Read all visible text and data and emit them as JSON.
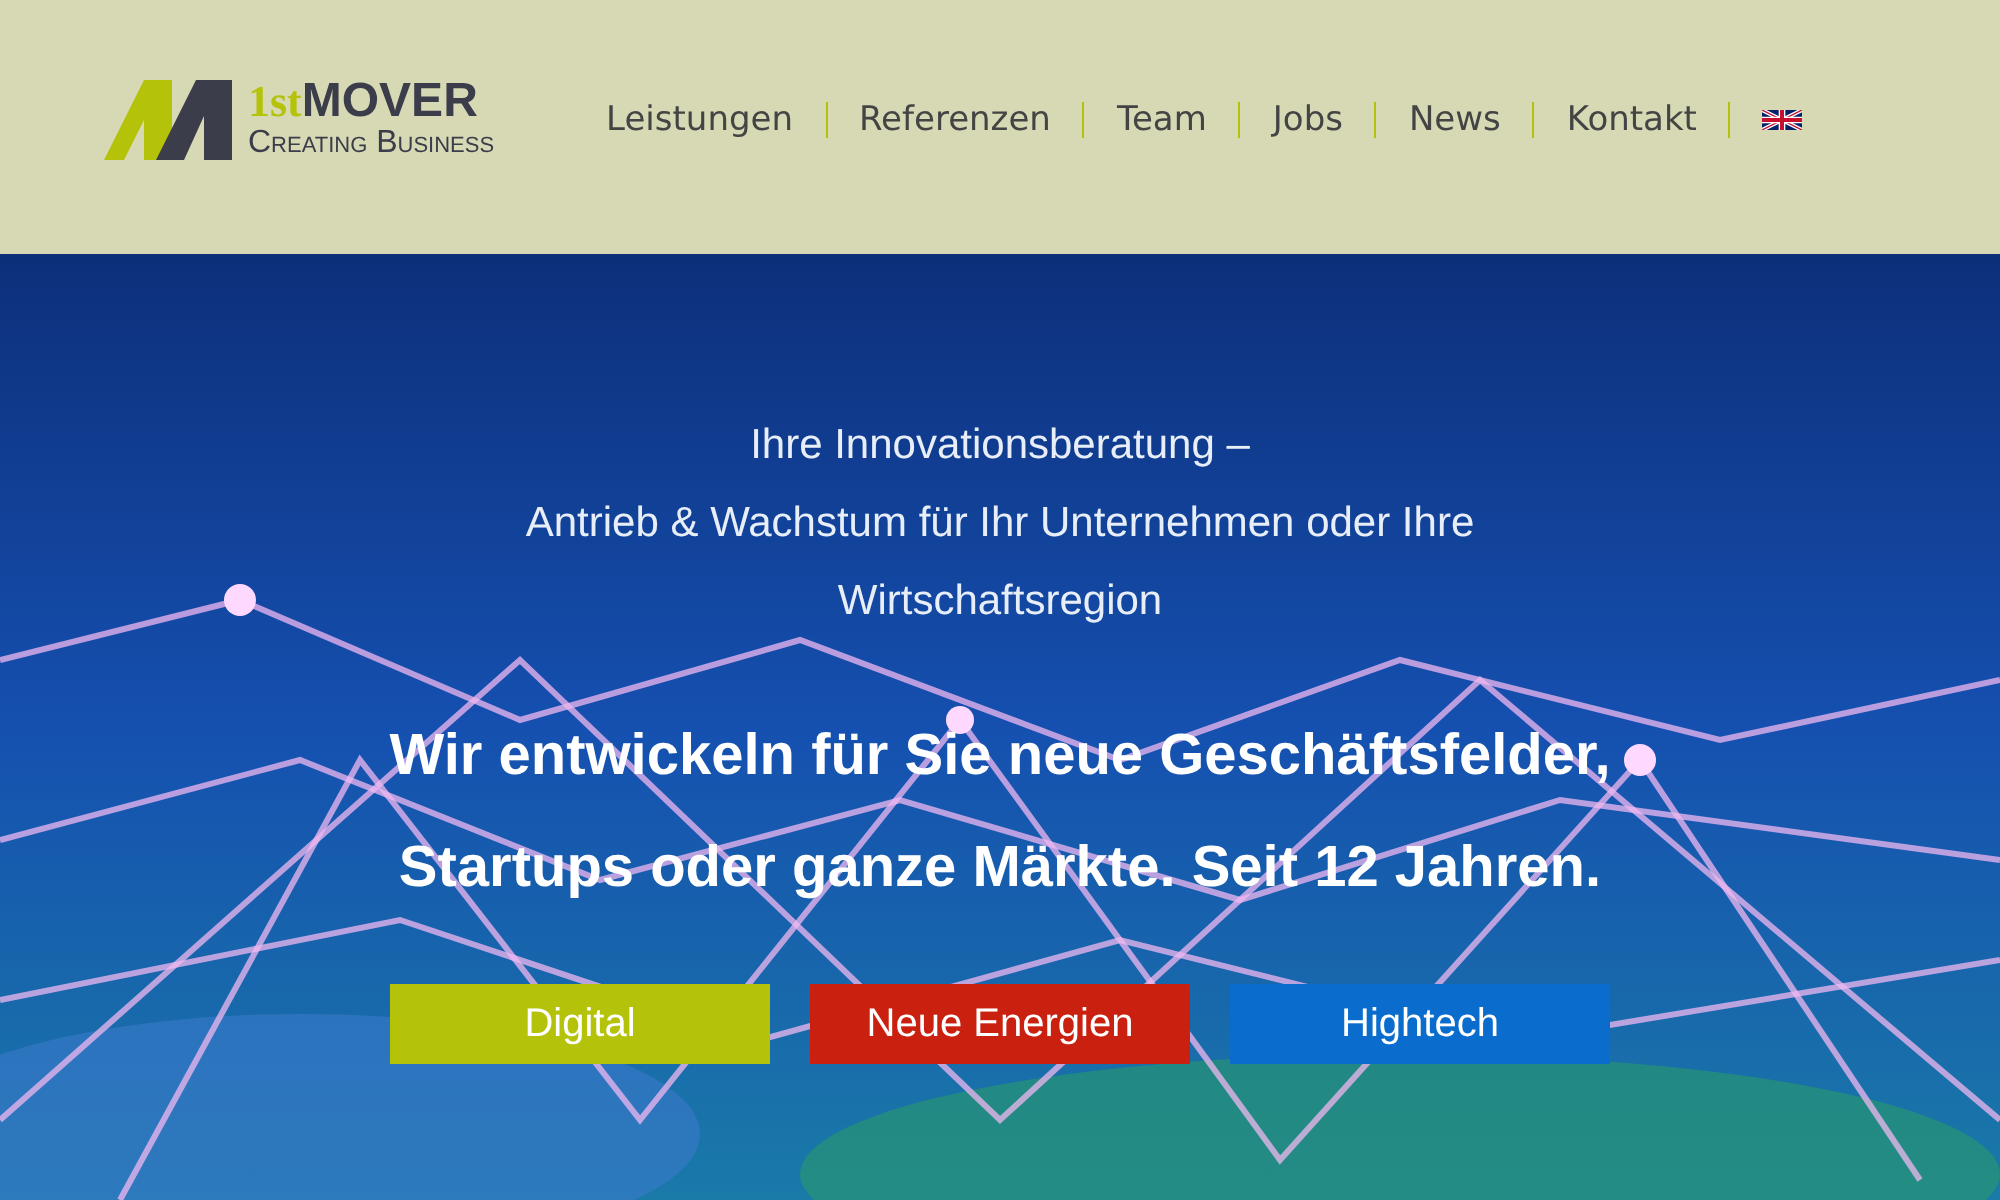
{
  "logo": {
    "prefix": "1st",
    "name": "MOVER",
    "tagline": "Creating Business"
  },
  "nav": [
    {
      "label": "Leistungen"
    },
    {
      "label": "Referenzen"
    },
    {
      "label": "Team"
    },
    {
      "label": "Jobs"
    },
    {
      "label": "News"
    },
    {
      "label": "Kontakt"
    }
  ],
  "hero": {
    "kind": "picture",
    "intro": [
      "Ihre Innovationsberatung –",
      "Antrieb & Wachstum für Ihr Unternehmen oder Ihre",
      "Wirtschaftsregion"
    ],
    "headline": [
      "Wir entwickeln für Sie neue Geschäftsfelder,",
      "Startups oder ganze Märkte. Seit 12 Jahren."
    ],
    "buttons": [
      {
        "label": "Digital",
        "color": "#b5c20a"
      },
      {
        "label": "Neue Energien",
        "color": "#c9200f"
      },
      {
        "label": "Hightech",
        "color": "#0a6ccc"
      }
    ]
  }
}
